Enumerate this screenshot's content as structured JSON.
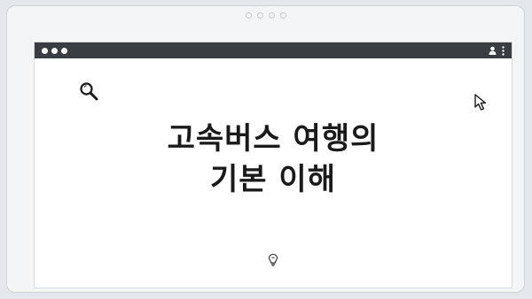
{
  "window": {
    "title_dots": 3
  },
  "heading": {
    "line1": "고속버스 여행의",
    "line2": "기본 이해"
  },
  "icons": {
    "search": "search-icon",
    "cursor": "cursor-icon",
    "bulb": "lightbulb-icon",
    "user": "user-icon",
    "menu": "kebab-menu-icon"
  },
  "colors": {
    "titlebar": "#3a3d41",
    "background": "#e4e8ec",
    "heading_text": "#1a1a1a"
  }
}
